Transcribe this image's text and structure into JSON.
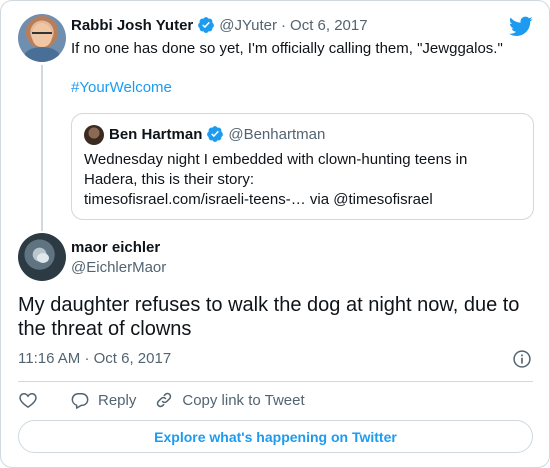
{
  "parent_tweet": {
    "author_name": "Rabbi Josh Yuter",
    "handle": "@JYuter",
    "separator": "·",
    "date": "Oct 6, 2017",
    "text": "If no one has done so yet, I'm officially calling them, \"Jewggalos.\"",
    "hashtag": "#YourWelcome"
  },
  "quoted_tweet": {
    "author_name": "Ben Hartman",
    "handle": "@Benhartman",
    "text_line1": "Wednesday night I embedded with clown-hunting teens in",
    "text_line2": "Hadera, this is their story:",
    "text_line3": "timesofisrael.com/israeli-teens-… via @timesofisrael"
  },
  "main_tweet": {
    "author_name": "maor eichler",
    "handle": "@EichlerMaor",
    "text": "My daughter refuses to walk the dog at night now, due to the threat of clowns",
    "time": "11:16 AM",
    "separator": "·",
    "date": "Oct 6, 2017"
  },
  "actions": {
    "reply_label": "Reply",
    "copy_label": "Copy link to Tweet"
  },
  "explore_label": "Explore what's happening on Twitter",
  "colors": {
    "accent": "#1d9bf0",
    "text": "#0f1419",
    "muted": "#536471",
    "border": "#cfd9de"
  },
  "icons": {
    "brand": "twitter-bird-icon",
    "verified": "verified-badge-icon",
    "info": "info-icon",
    "like": "heart-icon",
    "reply": "reply-bubble-icon",
    "copy": "link-icon"
  }
}
